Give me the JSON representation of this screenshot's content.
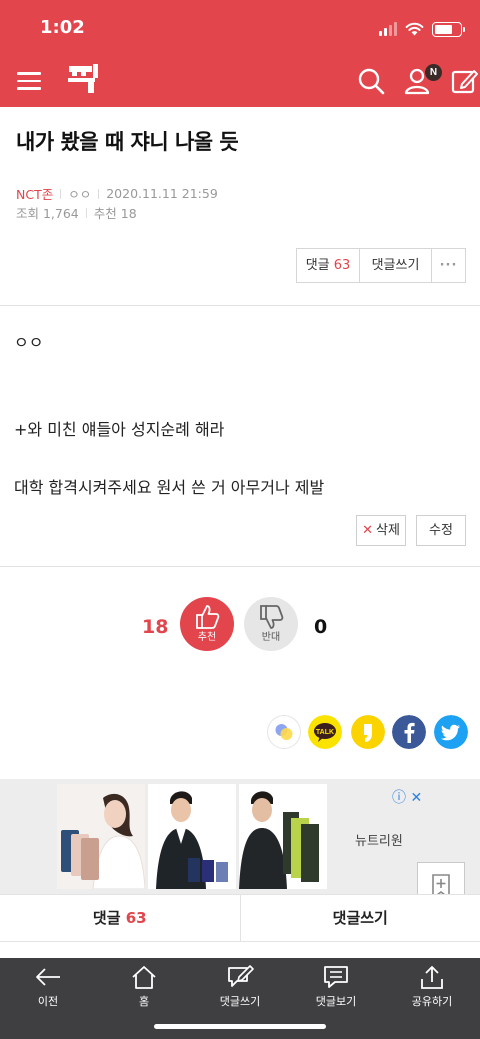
{
  "status": {
    "time": "1:02"
  },
  "header": {
    "badge": "N"
  },
  "post": {
    "title": "내가 봤을 때 쟈니 나올 듯",
    "category": "NCT존",
    "author": "ㅇㅇ",
    "datetime": "2020.11.11 21:59",
    "views": "조회 1,764",
    "likes_meta": "추천 18",
    "body": [
      "ㅇㅇ",
      "+와 미친 얘들아 성지순례 해라",
      "대학 합격시켜주세요 원서 쓴 거 아무거나 제발"
    ]
  },
  "actions": {
    "comment_label": "댓글",
    "comment_count": "63",
    "write_label": "댓글쓰기",
    "more_label": "···",
    "delete_label": "삭제",
    "edit_label": "수정"
  },
  "vote": {
    "up_count": "18",
    "up_label": "추천",
    "down_label": "반대",
    "down_count": "0"
  },
  "ad": {
    "brand": "뉴트리원",
    "info": "ⓘ ✕"
  },
  "comment_bar": {
    "comments_label": "댓글",
    "comments_count": "63",
    "write_label": "댓글쓰기"
  },
  "bottom_nav": [
    {
      "label": "이전",
      "icon": "back-arrow-icon"
    },
    {
      "label": "홈",
      "icon": "home-icon"
    },
    {
      "label": "댓글쓰기",
      "icon": "write-comment-icon"
    },
    {
      "label": "댓글보기",
      "icon": "view-comments-icon"
    },
    {
      "label": "공유하기",
      "icon": "share-icon"
    }
  ],
  "colors": {
    "brand": "#e2454c",
    "nav": "#3f3f41"
  }
}
